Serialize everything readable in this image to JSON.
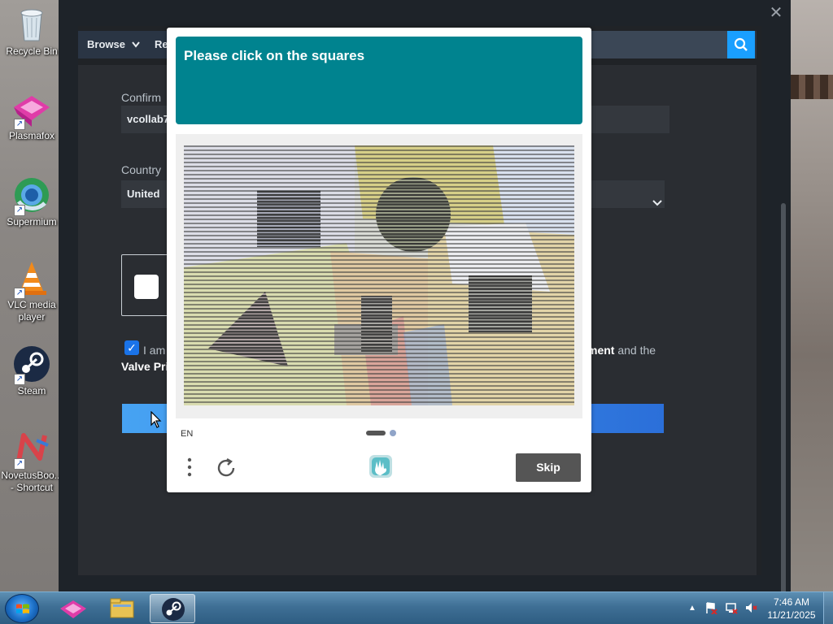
{
  "desktop": {
    "icons": [
      {
        "label": "Recycle Bin",
        "icon": "recycle-bin-icon"
      },
      {
        "label": "Plasmafox",
        "icon": "plasmafox-icon"
      },
      {
        "label": "Supermium",
        "icon": "supermium-icon"
      },
      {
        "label": "VLC media player",
        "icon": "vlc-icon"
      },
      {
        "label": "Steam",
        "icon": "steam-icon"
      },
      {
        "label": "NovetusBoo... - Shortcut",
        "icon": "novetus-icon"
      }
    ]
  },
  "steam": {
    "nav": {
      "browse_label": "Browse",
      "second_label_partial": "Re"
    },
    "form": {
      "confirm_label": "Confirm",
      "confirm_value": "vcollab7",
      "country_label": "Country",
      "country_value": "United",
      "agree_text_left": "I am",
      "agree_text_right_bold": "ment",
      "agree_text_right_rest": " and the",
      "valve_privacy_partial": "Valve Pri"
    }
  },
  "captcha": {
    "prompt": "Please click on the squares",
    "language": "EN",
    "skip_label": "Skip",
    "page_indicator": {
      "current": 1,
      "total": 2
    },
    "colors": {
      "header": "#00838f",
      "skip_button": "#555555"
    }
  },
  "taskbar": {
    "pinned": [
      "plasmafox-icon",
      "file-explorer-icon",
      "steam-icon"
    ],
    "active": "steam-icon",
    "clock_time": "7:46 AM",
    "clock_date": "11/21/2025"
  }
}
